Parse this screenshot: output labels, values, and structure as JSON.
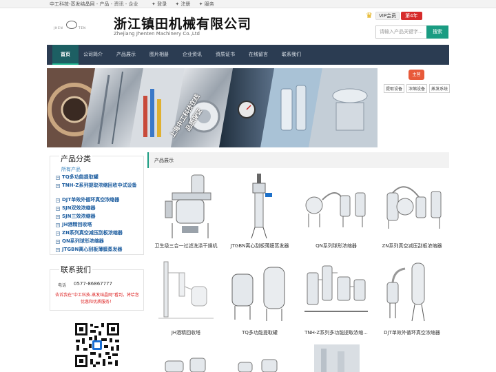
{
  "topbar": {
    "site": "中工科技-蒸发结晶网 - 产品 - 资讯 - 企业",
    "links": [
      "✦ 登录",
      "✦ 注册",
      "✦ 服务"
    ]
  },
  "header": {
    "logo_left": "JHEN",
    "logo_right": "TEN",
    "company_cn": "浙江镇田机械有限公司",
    "company_en": "Zhejiang Jhenten Machinery Co.,Ltd",
    "vip_label": "VIP会员",
    "vip_year": "第4年",
    "search_placeholder": "请输入产品关键字...",
    "search_button": "搜索"
  },
  "nav": {
    "items": [
      "首页",
      "公司简介",
      "产品展示",
      "图片相册",
      "企业资讯",
      "资质证书",
      "在线留言",
      "联系我们"
    ]
  },
  "banner": {
    "slogan_line1": "上海中工科技在线",
    "slogan_line2": "品质保证"
  },
  "side_tag": "主营",
  "tags": [
    "提取设备",
    "浓缩设备",
    "蒸发系统"
  ],
  "sidebar": {
    "title": "产品分类",
    "all_label": "所有产品",
    "categories": [
      "TQ多功能提取罐",
      "TNH-Z系列提取浓缩回收中试设备",
      "DJT单效外循环真空浓缩器",
      "SJN双效浓缩器",
      "SJN三效浓缩器",
      "JH酒精回收塔",
      "ZN系列真空减压刮板浓缩器",
      "QN系列球形浓缩器",
      "JTGBN离心刮板薄膜蒸发器"
    ],
    "contact_title": "联系我们",
    "phone_label": "电话",
    "phone": "0577-86867777",
    "notice": "告诉我在\"中工科技-蒸发结晶网\"看到，将给您优惠和优质服务！"
  },
  "products": {
    "header": "产品展示",
    "items": [
      "卫生级三合一过滤洗涤干燥机",
      "JTGBN离心刮板薄膜蒸发器",
      "QN系列球形浓缩器",
      "ZN系列真空减压刮板浓缩器",
      "JH酒精回收塔",
      "TQ多功能提取罐",
      "TNH-Z系列多功能提取浓缩...",
      "DJT单效外循环真空浓缩器"
    ]
  }
}
